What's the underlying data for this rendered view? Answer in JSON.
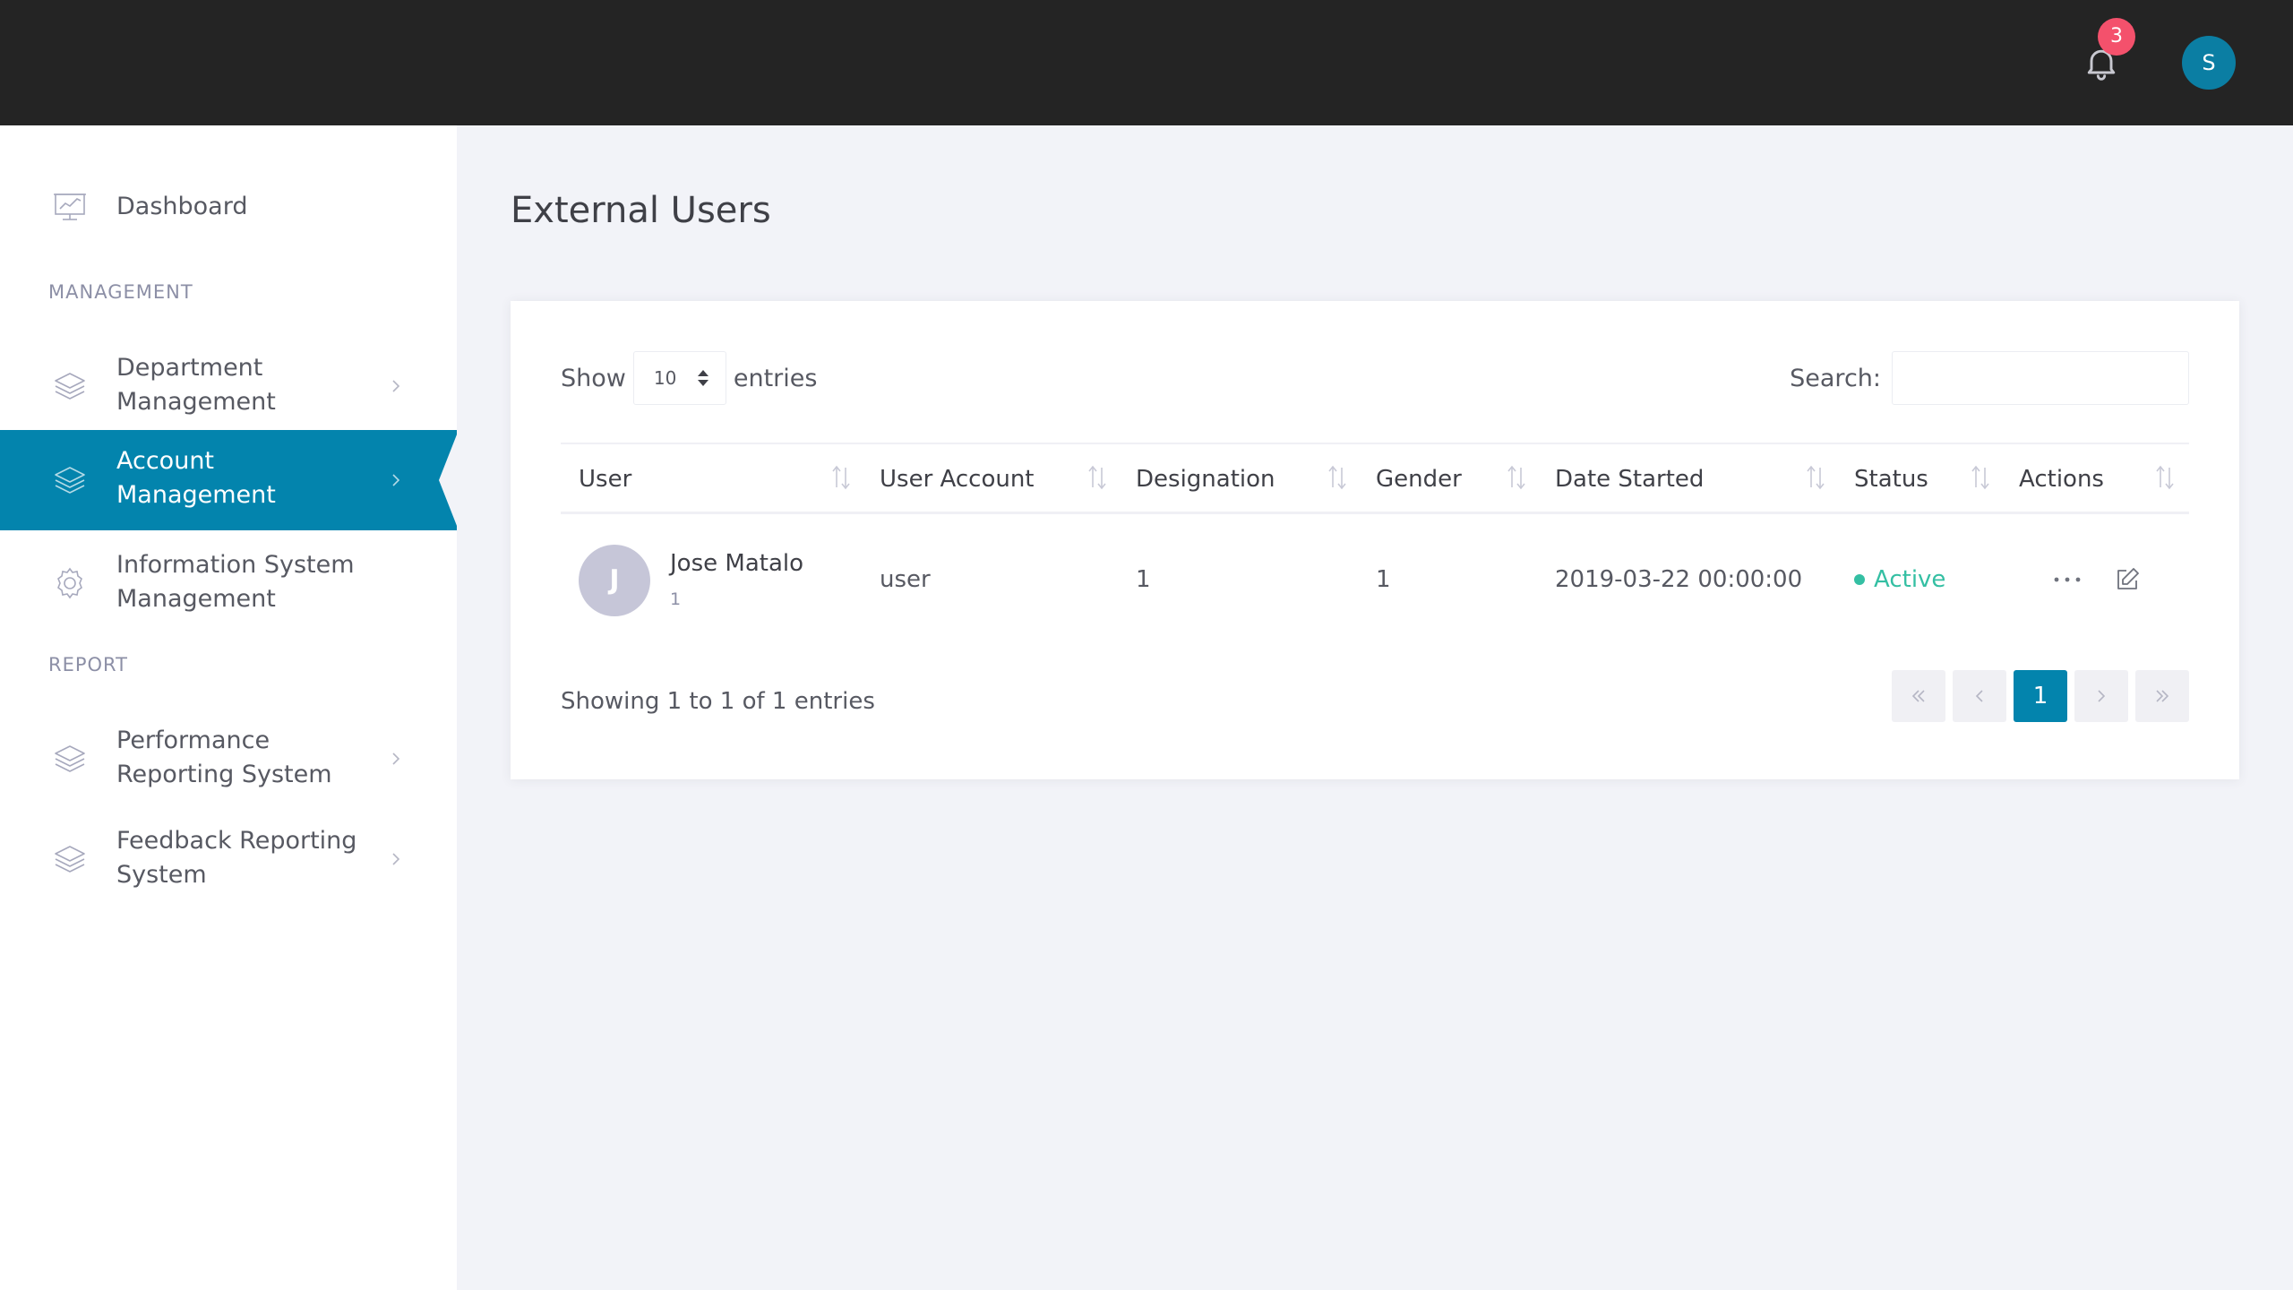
{
  "topbar": {
    "notification_count": "3",
    "user_initial": "S",
    "accent": "#0b7ea3",
    "badge_color": "#f4516c"
  },
  "sidebar": {
    "dashboard": {
      "label": "Dashboard",
      "icon": "presentation-chart-icon"
    },
    "section_management": "MANAGEMENT",
    "items_management": [
      {
        "label": "Department Management",
        "icon": "layers-icon"
      },
      {
        "label": "Account Management",
        "icon": "layers-icon",
        "active": true
      },
      {
        "label": "Information System Management",
        "icon": "gear-icon"
      }
    ],
    "section_report": "REPORT",
    "items_report": [
      {
        "label": "Performance Reporting System",
        "icon": "layers-icon"
      },
      {
        "label": "Feedback Reporting System",
        "icon": "layers-icon"
      }
    ],
    "active_color": "#0384ad"
  },
  "main": {
    "title": "External Users",
    "show_label": "Show",
    "entries_value": "10",
    "entries_label": "entries",
    "search_label": "Search:",
    "search_value": "",
    "columns": [
      "User",
      "User Account",
      "Designation",
      "Gender",
      "Date Started",
      "Status",
      "Actions"
    ],
    "rows": [
      {
        "initial": "J",
        "name": "Jose Matalo",
        "sub": "1",
        "account": "user",
        "designation": "1",
        "gender": "1",
        "date_started": "2019-03-22 00:00:00",
        "status": "Active"
      }
    ],
    "info": "Showing 1 to 1 of 1 entries",
    "pagination": {
      "current": "1"
    },
    "status_color": "#34bfa3"
  }
}
